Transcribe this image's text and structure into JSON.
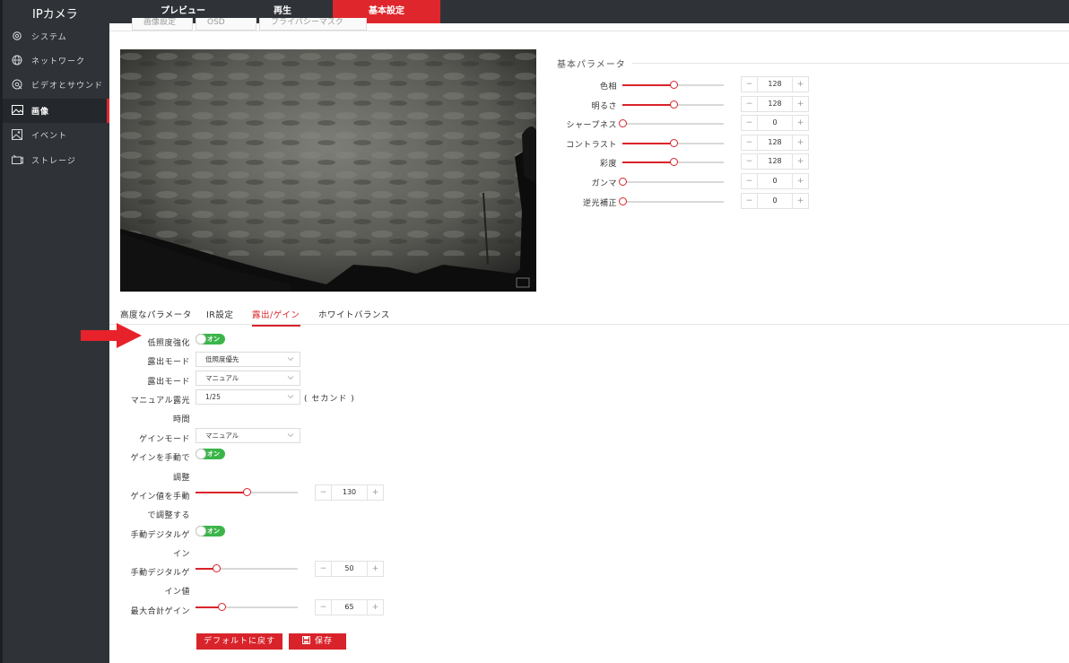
{
  "app": {
    "title": "IPカメラ"
  },
  "nav": [
    {
      "label": "プレビュー"
    },
    {
      "label": "再生"
    },
    {
      "label": "基本設定"
    }
  ],
  "sidebar": {
    "items": [
      {
        "label": "システム",
        "icon": "gear-icon"
      },
      {
        "label": "ネットワーク",
        "icon": "globe-icon"
      },
      {
        "label": "ビデオとサウンド",
        "icon": "video-sound-icon"
      },
      {
        "label": "画像",
        "icon": "image-icon"
      },
      {
        "label": "イベント",
        "icon": "event-icon"
      },
      {
        "label": "ストレージ",
        "icon": "storage-icon"
      }
    ]
  },
  "subtabs": [
    {
      "label": "画像設定"
    },
    {
      "label": "OSD"
    },
    {
      "label": "プライバシーマスク"
    }
  ],
  "basic_params": {
    "title": "基本パラメータ",
    "items": [
      {
        "label": "色相",
        "value": "128",
        "fraction": 0.5
      },
      {
        "label": "明るさ",
        "value": "128",
        "fraction": 0.5
      },
      {
        "label": "シャープネス",
        "value": "0",
        "fraction": 0
      },
      {
        "label": "コントラスト",
        "value": "128",
        "fraction": 0.5
      },
      {
        "label": "彩度",
        "value": "128",
        "fraction": 0.5
      },
      {
        "label": "ガンマ",
        "value": "0",
        "fraction": 0
      },
      {
        "label": "逆光補正",
        "value": "0",
        "fraction": 0
      }
    ]
  },
  "adv_tabs": [
    {
      "label": "高度なパラメータ"
    },
    {
      "label": "IR設定"
    },
    {
      "label": "露出/ゲイン"
    },
    {
      "label": "ホワイトバランス"
    }
  ],
  "exposure": {
    "low_light_label": "低照度強化",
    "toggle_on": "オン",
    "exposure_mode1_label": "露出モード",
    "exposure_mode1_value": "低照度優先",
    "exposure_mode2_label": "露出モード",
    "exposure_mode2_value": "マニュアル",
    "manual_exposure_label_1": "マニュアル露光",
    "manual_exposure_label_2": "時間",
    "manual_exposure_value": "1/25",
    "manual_exposure_unit": "( セカンド )",
    "gain_mode_label": "ゲインモード",
    "gain_mode_value": "マニュアル",
    "gain_manual_label_1": "ゲインを手動で",
    "gain_manual_label_2": "調整",
    "gain_value_label_1": "ゲイン値を手動",
    "gain_value_label_2": "で調整する",
    "gain_value": "130",
    "gain_fraction": 0.5,
    "digital_gain_label_1": "手動デジタルゲ",
    "digital_gain_label_2": "イン",
    "digital_gain_value_label_1": "手動デジタルゲ",
    "digital_gain_value_label_2": "イン値",
    "digital_gain_value": "50",
    "digital_gain_fraction": 0.2,
    "max_gain_label": "最大合計ゲイン",
    "max_gain_value": "65",
    "max_gain_fraction": 0.25
  },
  "buttons": {
    "default_label": "デフォルトに戻す",
    "save_label": "保存"
  }
}
